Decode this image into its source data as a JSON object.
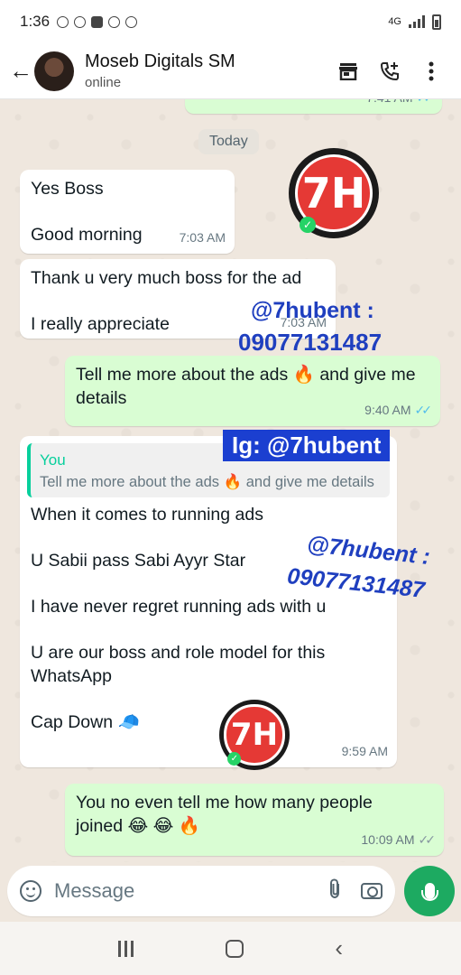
{
  "status_bar": {
    "time": "1:36",
    "network": "4G"
  },
  "header": {
    "back_icon": "arrow-left-icon",
    "contact_name": "Moseb Digitals SM",
    "status": "online"
  },
  "chat": {
    "prev_time": "7:41 AM",
    "date_chip": "Today",
    "messages": [
      {
        "dir": "in",
        "lines": [
          "Yes Boss",
          "Good morning"
        ],
        "time": "7:03 AM"
      },
      {
        "dir": "in",
        "lines": [
          "Thank u very much boss for the ad",
          "I really appreciate"
        ],
        "time": "7:03 AM"
      },
      {
        "dir": "out",
        "text": "Tell me more about the ads 🔥 and give me details",
        "time": "9:40 AM",
        "ticks": "read"
      },
      {
        "dir": "in",
        "quote_author": "You",
        "quote_text": "Tell me more about the ads 🔥 and give me details",
        "lines": [
          "When it comes to running ads",
          "U Sabii pass Sabi Ayyr Star",
          "I have never regret running ads with u",
          "U are our boss and role model for this WhatsApp",
          "Cap Down 🧢"
        ],
        "time": "9:59 AM"
      },
      {
        "dir": "out",
        "text": "You no even tell me how many people joined 😂 😂 🔥",
        "time": "10:09 AM",
        "ticks": "delivered"
      }
    ]
  },
  "watermarks": {
    "logo_text": "7H",
    "handle": "@7hubent :",
    "phone": "09077131487",
    "ig": "Ig: @7hubent"
  },
  "input": {
    "placeholder": "Message"
  }
}
